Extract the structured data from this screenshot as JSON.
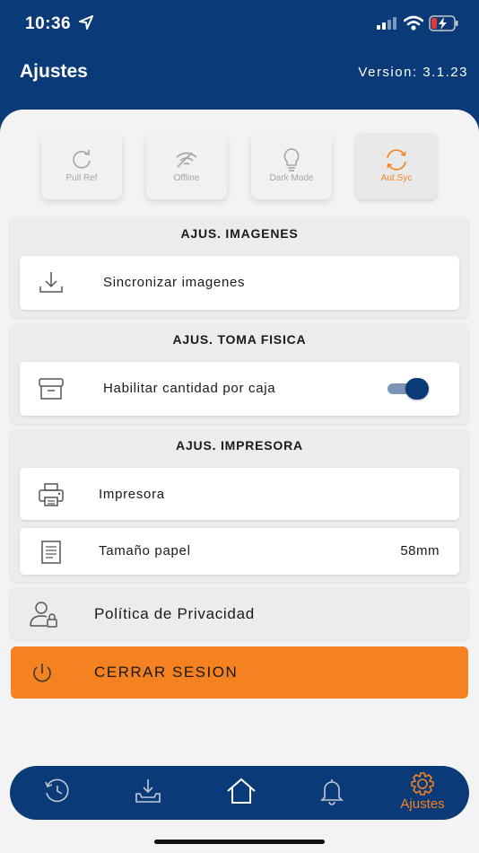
{
  "status_bar": {
    "time": "10:36",
    "icons": [
      "location-arrow-icon",
      "signal-icon",
      "wifi-icon",
      "battery-charging-icon"
    ]
  },
  "header": {
    "title": "Ajustes",
    "version": "Version: 3.1.23"
  },
  "quick_actions": [
    {
      "label": "Pull Ref",
      "icon": "refresh-icon",
      "active": false
    },
    {
      "label": "Offline",
      "icon": "wifi-off-icon",
      "active": false
    },
    {
      "label": "Dark Mode",
      "icon": "lightbulb-icon",
      "active": false
    },
    {
      "label": "Aut.Syc",
      "icon": "sync-icon",
      "active": true
    }
  ],
  "sections": {
    "imagenes": {
      "title": "AJUS. IMAGENES",
      "sync_label": "Sincronizar imagenes"
    },
    "toma_fisica": {
      "title": "AJUS. TOMA FISICA",
      "caja_label": "Habilitar cantidad por caja",
      "caja_enabled": true
    },
    "impresora": {
      "title": "AJUS. IMPRESORA",
      "printer_label": "Impresora",
      "paper_label": "Tamaño papel",
      "paper_value": "58mm"
    }
  },
  "privacy": {
    "label": "Política de Privacidad"
  },
  "logout": {
    "label": "CERRAR SESION"
  },
  "bottom_nav": [
    {
      "icon": "history-icon",
      "label": ""
    },
    {
      "icon": "download-tray-icon",
      "label": ""
    },
    {
      "icon": "home-icon",
      "label": ""
    },
    {
      "icon": "bell-icon",
      "label": ""
    },
    {
      "icon": "gear-icon",
      "label": "Ajustes",
      "active": true
    }
  ],
  "colors": {
    "primary": "#0a3a78",
    "accent": "#f58220",
    "background": "#f3f3f3"
  }
}
